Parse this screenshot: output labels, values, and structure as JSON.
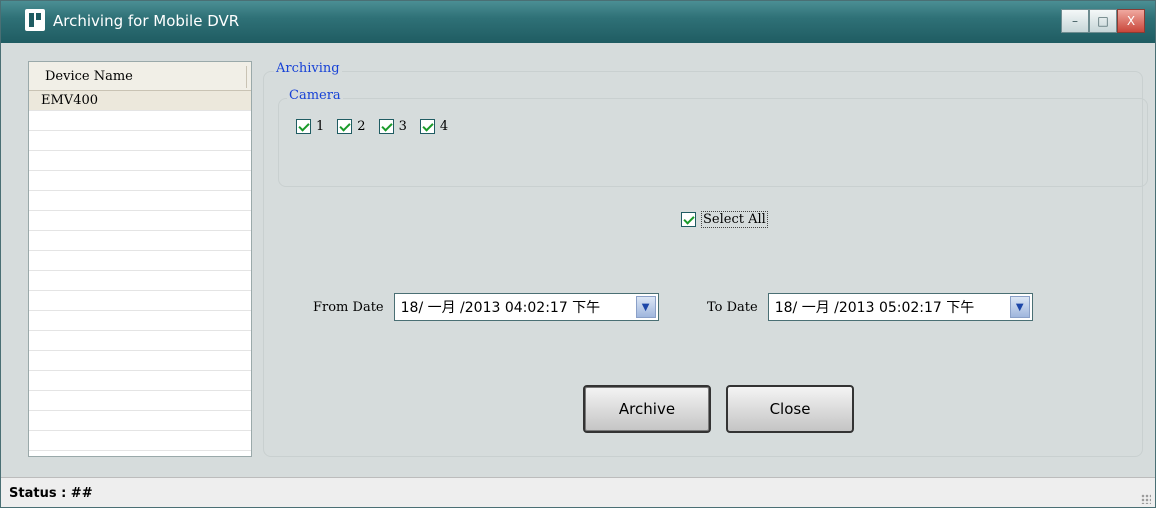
{
  "window": {
    "title": "Archiving for Mobile DVR",
    "controls": {
      "minimize": "–",
      "maximize": "□",
      "close": "X"
    }
  },
  "device_list": {
    "header": "Device Name",
    "rows": [
      "EMV400",
      "",
      "",
      "",
      "",
      "",
      "",
      "",
      "",
      "",
      "",
      "",
      "",
      "",
      "",
      "",
      "",
      ""
    ]
  },
  "archiving": {
    "group_label": "Archiving",
    "camera_group_label": "Camera",
    "cameras": [
      {
        "label": "1",
        "checked": true
      },
      {
        "label": "2",
        "checked": true
      },
      {
        "label": "3",
        "checked": true
      },
      {
        "label": "4",
        "checked": true
      }
    ],
    "select_all": {
      "label": "Select All",
      "checked": true
    },
    "from_date": {
      "label": "From Date",
      "value": "18/ 一月 /2013 04:02:17 下午"
    },
    "to_date": {
      "label": "To Date",
      "value": "18/ 一月 /2013 05:02:17 下午"
    },
    "buttons": {
      "archive": "Archive",
      "close": "Close"
    }
  },
  "status": {
    "text": "Status : ##"
  },
  "colors": {
    "titlebar": "#2f7177",
    "group_label": "#1742d6",
    "check": "#1a9a2a"
  }
}
